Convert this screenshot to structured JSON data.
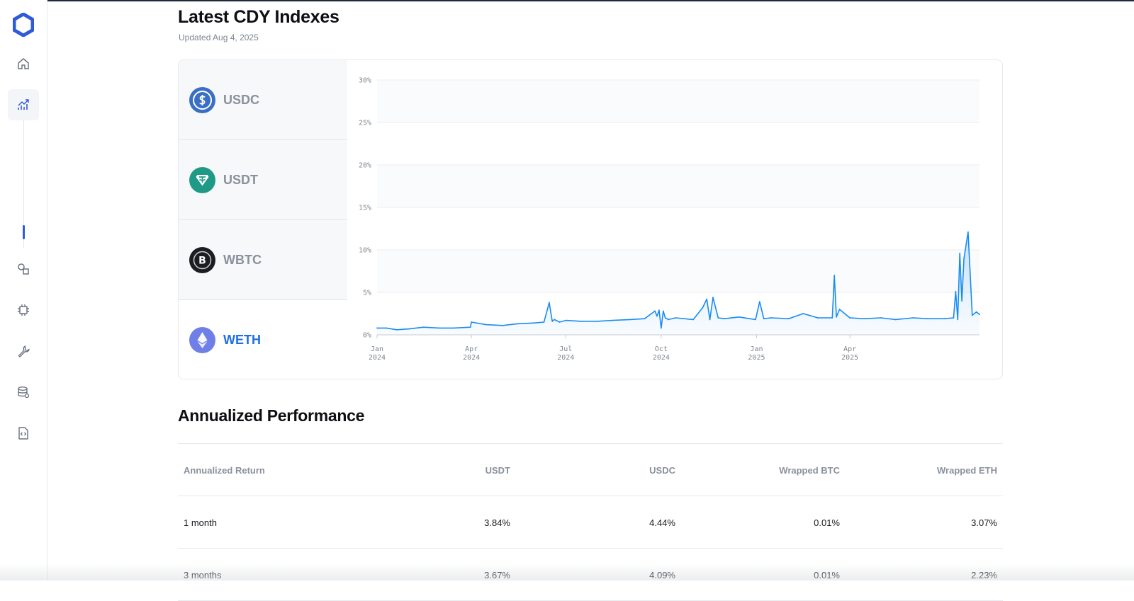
{
  "app": {
    "accent": "#1e6fe3",
    "brand": "#2f5bd8"
  },
  "sidebar": {
    "items": [
      {
        "icon": "home-icon",
        "active": false
      },
      {
        "icon": "chart-trend-icon",
        "active": true
      },
      {
        "icon": "shapes-icon",
        "active": false
      },
      {
        "icon": "chip-icon",
        "active": false
      },
      {
        "icon": "wrench-icon",
        "active": false
      },
      {
        "icon": "database-icon",
        "active": false
      },
      {
        "icon": "code-file-icon",
        "active": false
      }
    ]
  },
  "header": {
    "title": "Latest CDY Indexes",
    "updated": "Updated Aug 4, 2025"
  },
  "assets": [
    {
      "label": "USDC",
      "icon": "usdc-icon",
      "color": "#3a6fc4",
      "selected": false
    },
    {
      "label": "USDT",
      "icon": "usdt-icon",
      "color": "#1f9a86",
      "selected": false
    },
    {
      "label": "WBTC",
      "icon": "wbtc-icon",
      "color": "#1b1d22",
      "selected": false
    },
    {
      "label": "WETH",
      "icon": "weth-icon",
      "color": "#6f7fe8",
      "selected": true
    }
  ],
  "chart_data": {
    "type": "area",
    "series": [
      {
        "color": "#1a8cf0",
        "x": [
          "2024-01-01",
          "2024-01-10",
          "2024-01-20",
          "2024-02-01",
          "2024-02-15",
          "2024-03-01",
          "2024-03-15",
          "2024-03-31",
          "2024-04-01",
          "2024-04-15",
          "2024-05-01",
          "2024-05-15",
          "2024-06-01",
          "2024-06-10",
          "2024-06-15",
          "2024-06-18",
          "2024-06-20",
          "2024-06-25",
          "2024-07-01",
          "2024-07-15",
          "2024-08-01",
          "2024-08-15",
          "2024-09-01",
          "2024-09-15",
          "2024-09-25",
          "2024-09-27",
          "2024-09-29",
          "2024-10-01",
          "2024-10-03",
          "2024-10-05",
          "2024-10-08",
          "2024-10-15",
          "2024-11-01",
          "2024-11-10",
          "2024-11-14",
          "2024-11-17",
          "2024-11-20",
          "2024-11-25",
          "2024-12-01",
          "2024-12-15",
          "2024-12-31",
          "2025-01-04",
          "2025-01-08",
          "2025-01-15",
          "2025-02-01",
          "2025-02-15",
          "2025-03-01",
          "2025-03-15",
          "2025-03-17",
          "2025-03-19",
          "2025-03-22",
          "2025-04-01",
          "2025-04-15",
          "2025-05-01",
          "2025-05-15",
          "2025-06-01",
          "2025-06-15",
          "2025-07-01",
          "2025-07-10",
          "2025-07-12",
          "2025-07-14",
          "2025-07-16",
          "2025-07-18",
          "2025-07-20",
          "2025-07-24",
          "2025-07-28",
          "2025-08-01",
          "2025-08-04"
        ],
        "values": [
          0.8,
          0.8,
          0.6,
          0.7,
          0.9,
          0.8,
          0.8,
          0.9,
          1.5,
          1.2,
          1.1,
          1.3,
          1.4,
          1.5,
          3.8,
          1.6,
          1.8,
          1.5,
          1.7,
          1.6,
          1.6,
          1.7,
          1.8,
          1.9,
          2.8,
          2.2,
          2.9,
          0.8,
          2.8,
          2.0,
          1.8,
          2.0,
          1.8,
          3.2,
          4.2,
          1.8,
          4.4,
          2.0,
          1.9,
          2.1,
          1.8,
          3.9,
          1.9,
          2.0,
          1.9,
          2.5,
          2.0,
          2.0,
          7.0,
          2.1,
          3.0,
          2.0,
          1.9,
          2.0,
          1.8,
          2.0,
          1.9,
          1.9,
          2.0,
          5.1,
          1.8,
          9.6,
          4.0,
          9.0,
          12.1,
          2.3,
          2.7,
          2.4
        ]
      }
    ],
    "x_ticks": [
      {
        "line1": "Jan",
        "line2": "2024"
      },
      {
        "line1": "Apr",
        "line2": "2024"
      },
      {
        "line1": "Jul",
        "line2": "2024"
      },
      {
        "line1": "Oct",
        "line2": "2024"
      },
      {
        "line1": "Jan",
        "line2": "2025"
      },
      {
        "line1": "Apr",
        "line2": "2025"
      }
    ],
    "y_ticks": [
      "0%",
      "5%",
      "10%",
      "15%",
      "20%",
      "25%",
      "30%"
    ],
    "ylim": [
      0,
      30
    ],
    "xlim": [
      "2024-01-01",
      "2025-08-04"
    ],
    "grid": true
  },
  "performance": {
    "title": "Annualized Performance",
    "headers": [
      "Annualized Return",
      "USDT",
      "USDC",
      "Wrapped BTC",
      "Wrapped ETH"
    ],
    "rows": [
      [
        "1 month",
        "3.84%",
        "4.44%",
        "0.01%",
        "3.07%"
      ],
      [
        "3 months",
        "3.67%",
        "4.09%",
        "0.01%",
        "2.23%"
      ]
    ]
  }
}
